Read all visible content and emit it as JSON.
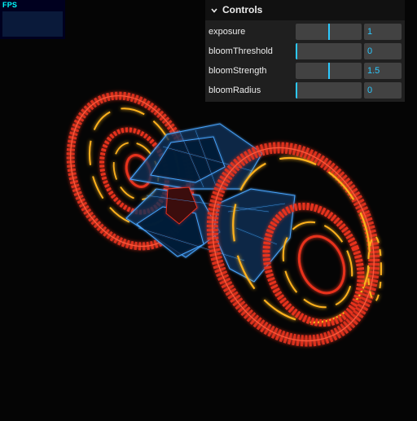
{
  "fps": {
    "label": "FPS"
  },
  "gui": {
    "title": "Controls",
    "controls": [
      {
        "name": "exposure",
        "value": "1",
        "fraction": 0.5
      },
      {
        "name": "bloomThreshold",
        "value": "0",
        "fraction": 0.0
      },
      {
        "name": "bloomStrength",
        "value": "1.5",
        "fraction": 0.5
      },
      {
        "name": "bloomRadius",
        "value": "0",
        "fraction": 0.0
      }
    ]
  },
  "colors": {
    "background": "#050505",
    "accent": "#2cc9ff",
    "ring_red": "#ff3b2a",
    "ring_orange": "#ffb21f",
    "body_blue": "#4aa6ff"
  }
}
